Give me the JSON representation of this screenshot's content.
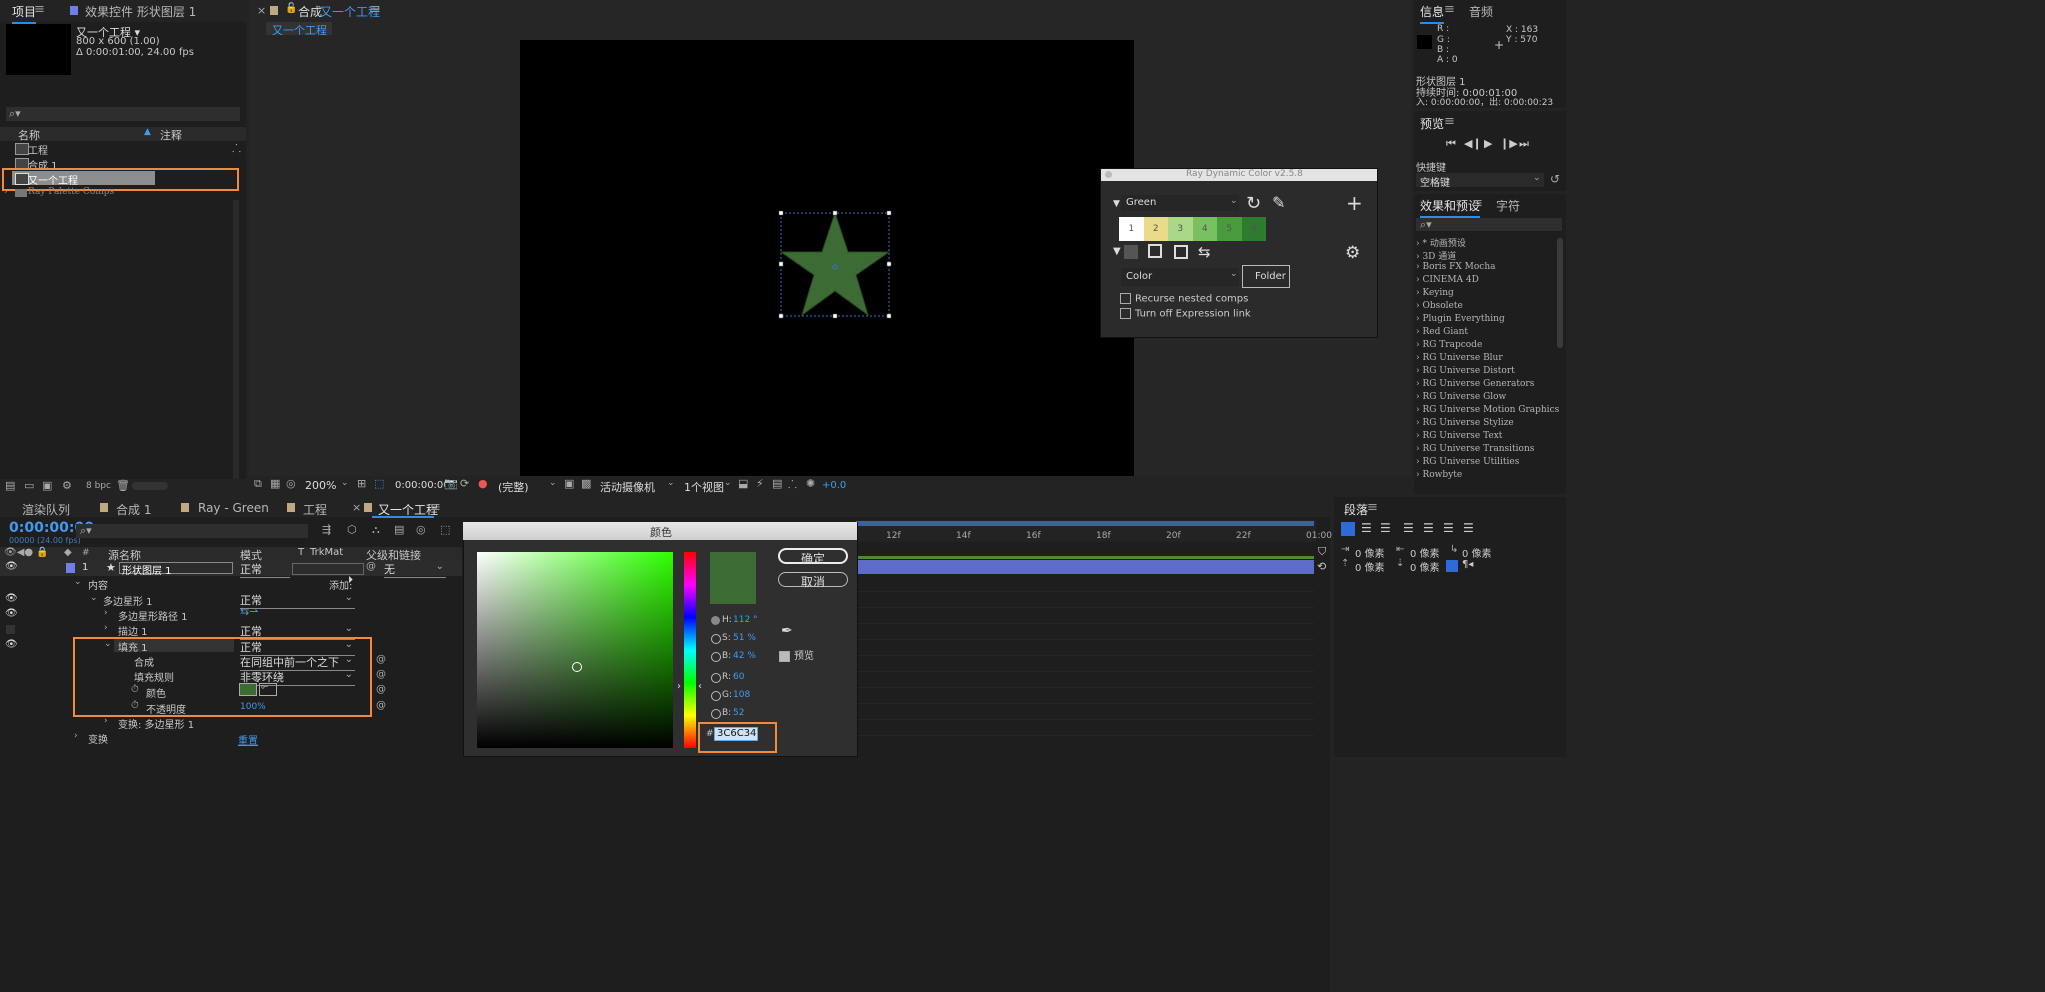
{
  "project_panel": {
    "tab_project": "项目",
    "tab_effects": "效果控件 形状图层 1",
    "comp_name": "又一个工程 ▾",
    "comp_size": "800 x 600 (1.00)",
    "comp_duration": "Δ 0:00:01:00, 24.00 fps",
    "search_placeholder": "⌕▾",
    "col_name": "名称",
    "col_comment": "注释",
    "items": [
      "工程",
      "合成 1",
      "又一个工程",
      "Ray Palette Comps"
    ],
    "bpc": "8 bpc"
  },
  "composition_panel": {
    "tab_label": "合成",
    "tab_name": "又一个工程",
    "breadcrumb": "又一个工程",
    "zoom": "200%",
    "timecode": "0:00:00:00",
    "quality": "(完整)",
    "camera": "活动摄像机",
    "views": "1个视图",
    "exposure": "+0.0",
    "star_color": "#3c6c34"
  },
  "ray_dynamic_color": {
    "title": "Ray Dynamic Color v2.5.8",
    "palette_name": "Green",
    "swatches": [
      {
        "n": "1",
        "color": "#ffffff"
      },
      {
        "n": "2",
        "color": "#e8dc8a"
      },
      {
        "n": "3",
        "color": "#a8d888"
      },
      {
        "n": "4",
        "color": "#78c060"
      },
      {
        "n": "5",
        "color": "#4a9a3e"
      },
      {
        "n": "6",
        "color": "#2e7a2e"
      }
    ],
    "mode": "Color",
    "folder_button": "Folder",
    "opt_recurse": "Recurse nested comps",
    "opt_expression": "Turn off Expression link"
  },
  "info_panel": {
    "tab_info": "信息",
    "tab_audio": "音频",
    "r": "R :",
    "g": "G :",
    "b": "B :",
    "a": "A : 0",
    "x": "X : 163",
    "y": "Y : 570",
    "layer": "形状图层 1",
    "duration": "持续时间: 0:00:01:00",
    "in_out": "入: 0:00:00:00，出: 0:00:00:23"
  },
  "preview_panel": {
    "title": "预览",
    "shortcut_label": "快捷键",
    "shortcut_value": "空格键"
  },
  "effects_panel": {
    "tab_effects": "效果和预设",
    "tab_char": "字符",
    "search_placeholder": "⌕▾",
    "items": [
      "* 动画预设",
      "3D 通道",
      "Boris FX Mocha",
      "CINEMA 4D",
      "Keying",
      "Obsolete",
      "Plugin Everything",
      "Red Giant",
      "RG Trapcode",
      "RG Universe Blur",
      "RG Universe Distort",
      "RG Universe Generators",
      "RG Universe Glow",
      "RG Universe Motion Graphics",
      "RG Universe Stylize",
      "RG Universe Text",
      "RG Universe Transitions",
      "RG Universe Utilities",
      "Rowbyte"
    ]
  },
  "timeline": {
    "tabs": [
      "渲染队列",
      "合成 1",
      "Ray - Green",
      "工程",
      "又一个工程"
    ],
    "timecode": "0:00:00:00",
    "timecode_sub": "00000 (24.00 fps)",
    "search_placeholder": "⌕▾",
    "col_source": "源名称",
    "col_mode": "模式",
    "col_t": "T",
    "col_trkmat": "TrkMat",
    "col_parent": "父级和链接",
    "layer_num": "1",
    "layer_name": "形状图层 1",
    "layer_mode": "正常",
    "layer_parent": "无",
    "content": "内容",
    "add": "添加:",
    "polystar": "多边星形 1",
    "polystar_mode": "正常",
    "polystar_path": "多边星形路径 1",
    "stroke": "描边 1",
    "stroke_mode": "正常",
    "fill": "填充 1",
    "fill_mode": "正常",
    "composite": "合成",
    "composite_value": "在同组中前一个之下",
    "fill_rule": "填充规则",
    "fill_rule_value": "非零环绕",
    "color": "颜色",
    "opacity": "不透明度",
    "opacity_value": "100%",
    "transform_poly": "变换: 多边星形 1",
    "transform": "变换",
    "reset": "重置",
    "ruler": [
      "12f",
      "14f",
      "16f",
      "18f",
      "20f",
      "22f",
      "01:00"
    ]
  },
  "color_dialog": {
    "title": "颜色",
    "ok": "确定",
    "cancel": "取消",
    "h_label": "H:",
    "h": "112 °",
    "s_label": "S:",
    "s": "51 %",
    "bv_label": "B:",
    "bv": "42 %",
    "r_label": "R:",
    "r": "60",
    "g_label": "G:",
    "g": "108",
    "b_label": "B:",
    "b": "52",
    "hash": "#",
    "hex": "3C6C34",
    "preview_label": "预览"
  },
  "paragraph_panel": {
    "title": "段落",
    "indent_left": "0 像素",
    "indent_right": "0 像素",
    "indent_first": "0 像素",
    "space_before": "0 像素",
    "space_after": "0 像素"
  }
}
